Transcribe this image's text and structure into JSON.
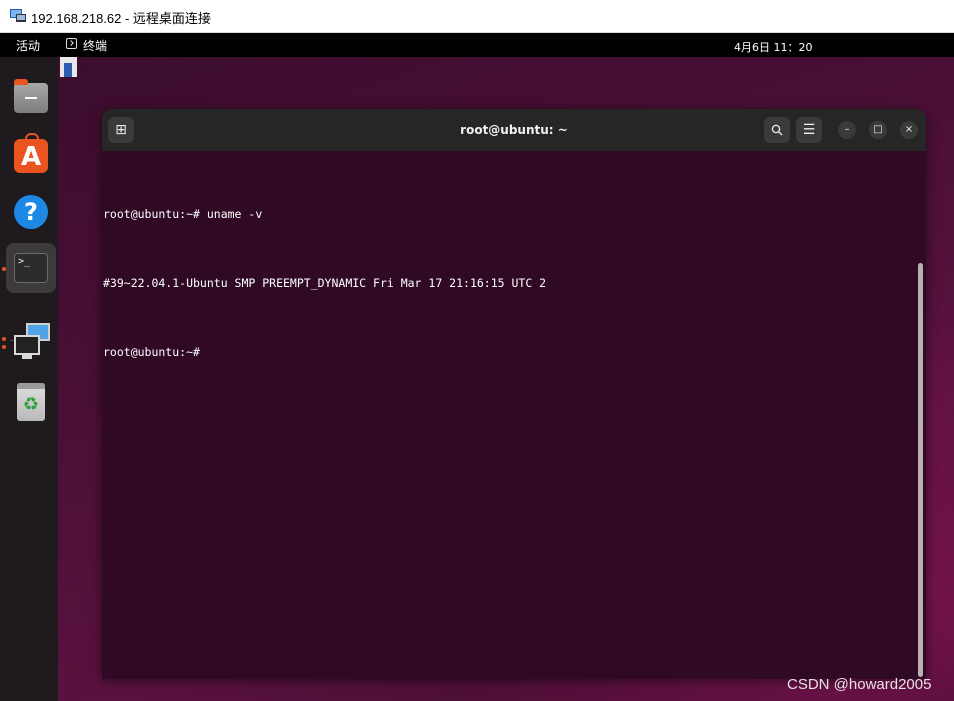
{
  "rdp_window": {
    "title": "192.168.218.62 - 远程桌面连接"
  },
  "topbar": {
    "activities": "活动",
    "app_name": "终端",
    "clock": "4月6日  11：20"
  },
  "dock": {
    "items": [
      {
        "name": "files",
        "icon": "folder-icon"
      },
      {
        "name": "software",
        "icon": "app-store-icon",
        "glyph": "A"
      },
      {
        "name": "help",
        "icon": "help-icon",
        "glyph": "?"
      },
      {
        "name": "terminal",
        "icon": "terminal-icon",
        "glyph": ">_",
        "active": true
      },
      {
        "name": "remote-desktop",
        "icon": "remote-desktop-icon"
      },
      {
        "name": "trash",
        "icon": "trash-icon",
        "glyph": "♻"
      }
    ]
  },
  "terminal": {
    "title": "root@ubuntu: ~",
    "lines": [
      "root@ubuntu:~# uname -v",
      "#39~22.04.1-Ubuntu SMP PREEMPT_DYNAMIC Fri Mar 17 21:16:15 UTC 2",
      "root@ubuntu:~# "
    ],
    "buttons": {
      "new_tab": "⊞",
      "search": "🔍",
      "menu": "☰",
      "minimize": "–",
      "maximize": "□",
      "close": "×"
    }
  },
  "watermark": "CSDN @howard2005",
  "colors": {
    "terminal_bg": "#300a24",
    "accent": "#e95420"
  }
}
